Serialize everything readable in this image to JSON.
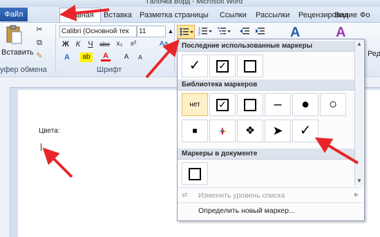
{
  "titlebar": {
    "title": "Галочка Ворд - Microsoft Word"
  },
  "tabs": {
    "file": "Файл",
    "home": "Главная",
    "insert": "Вставка",
    "layout": "Разметка страницы",
    "refs": "Ссылки",
    "mailings": "Рассылки",
    "review": "Рецензирование",
    "view": "Вид",
    "format": "Фо"
  },
  "ribbon": {
    "paste_label": "Вставить",
    "clipboard_group": "уфер обмена",
    "font_group": "Шрифт",
    "font_name": "Calibri (Основной тек",
    "font_size": "11",
    "bold": "Ж",
    "italic": "К",
    "underline": "Ч",
    "strike": "abe",
    "subscript": "x₂",
    "superscript": "x²",
    "grow": "A",
    "shrink": "A",
    "styles_right": "Реда"
  },
  "document": {
    "heading": "Цвета:",
    "cursor": "|"
  },
  "panel": {
    "recent_header": "Последние использованные маркеры",
    "library_header": "Библиотека маркеров",
    "doc_header": "Маркеры в документе",
    "none_label": "нет",
    "recent": [
      "check",
      "checkbox",
      "square"
    ],
    "library_row1": [
      "none",
      "checkbox",
      "square",
      "dash",
      "dot",
      "circle"
    ],
    "library_row2": [
      "small-square",
      "flower",
      "diamonds",
      "arrowhead",
      "check"
    ],
    "doc_markers": [
      "square"
    ],
    "change_level": "Изменить уровень списка",
    "define_new": "Определить новый маркер..."
  },
  "colors": {
    "accent": "#2b579a",
    "arrow": "#e8262a",
    "highlight": "#fde49a"
  }
}
